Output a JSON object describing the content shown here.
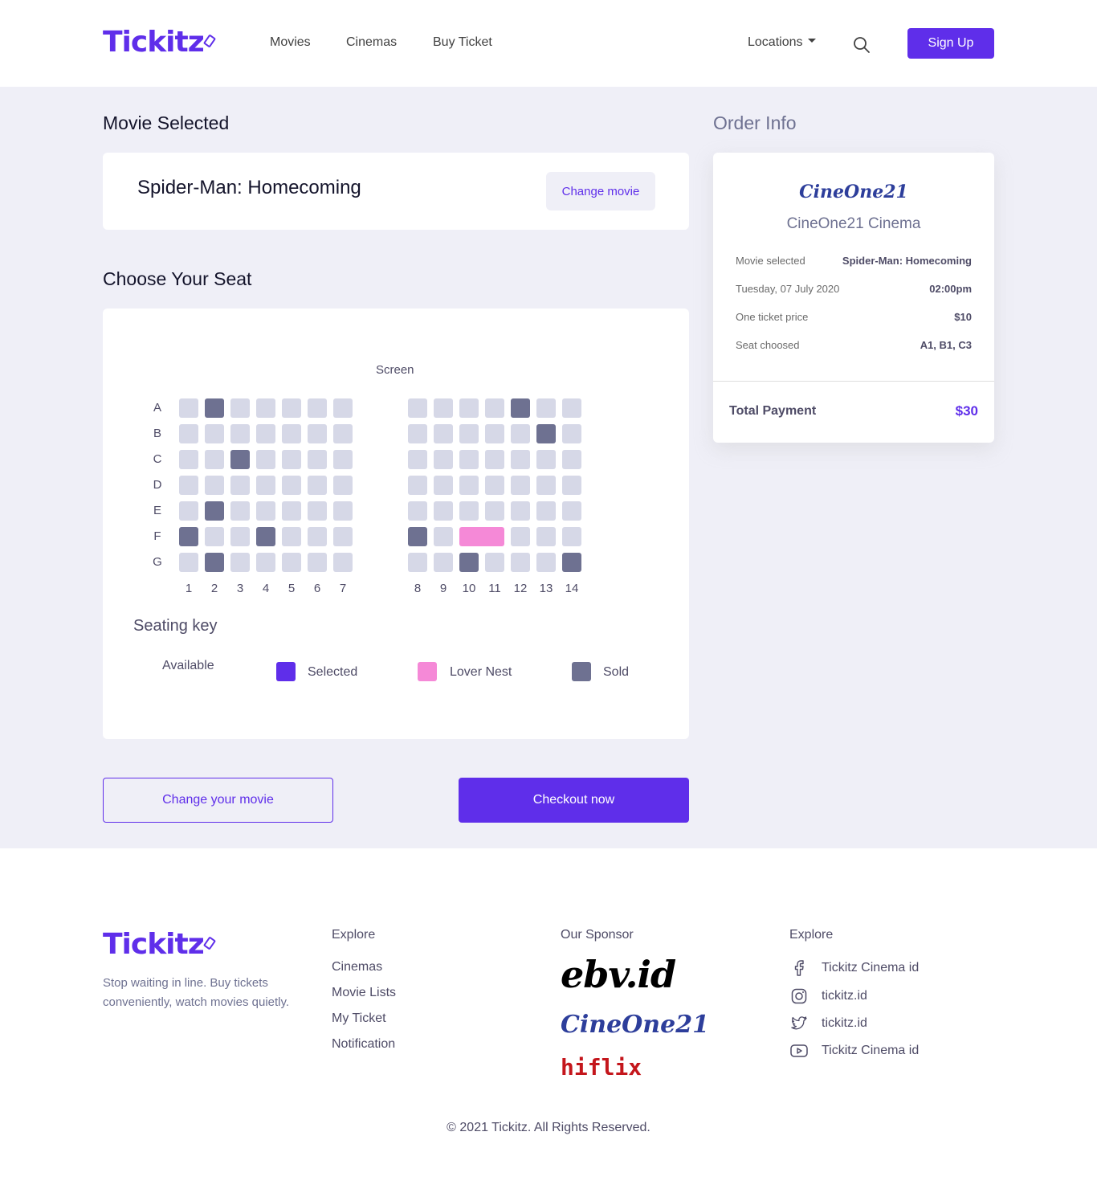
{
  "header": {
    "logo": "Tickitz",
    "nav": [
      "Movies",
      "Cinemas",
      "Buy Ticket"
    ],
    "locations": "Locations",
    "signup": "Sign Up"
  },
  "movie_selected": {
    "title": "Movie Selected",
    "movie": "Spider-Man: Homecoming",
    "change_button": "Change movie"
  },
  "seat_section": {
    "title": "Choose Your Seat",
    "screen": "Screen",
    "rows": [
      "A",
      "B",
      "C",
      "D",
      "E",
      "F",
      "G"
    ],
    "columns": [
      "1",
      "2",
      "3",
      "4",
      "5",
      "6",
      "7",
      "8",
      "9",
      "10",
      "11",
      "12",
      "13",
      "14"
    ],
    "sold": [
      "A2",
      "A12",
      "B13",
      "C3",
      "E2",
      "F1",
      "F4",
      "F8",
      "G2",
      "G10",
      "G14"
    ],
    "lover_nest": [
      "F10-F11"
    ],
    "seating_key_title": "Seating key",
    "keys": [
      "Available",
      "Selected",
      "Lover Nest",
      "Sold"
    ]
  },
  "actions": {
    "change": "Change your movie",
    "checkout": "Checkout now"
  },
  "order_info": {
    "title": "Order Info",
    "cinema_logo": "CineOne21",
    "cinema_name": "CineOne21 Cinema",
    "rows": [
      {
        "label": "Movie selected",
        "value": "Spider-Man: Homecoming"
      },
      {
        "label": "Tuesday, 07 July 2020",
        "value": "02:00pm"
      },
      {
        "label": "One ticket price",
        "value": "$10"
      },
      {
        "label": "Seat choosed",
        "value": "A1, B1, C3"
      }
    ],
    "total_label": "Total Payment",
    "total_value": "$30"
  },
  "colors": {
    "primary": "#5f2eea",
    "available": "#d6d8e7",
    "sold": "#6e7191",
    "lover_nest": "#f589d7",
    "background": "#efeff7"
  },
  "footer": {
    "logo": "Tickitz",
    "description": "Stop waiting in line. Buy tickets conveniently, watch movies quietly.",
    "explore_title": "Explore",
    "explore_links": [
      "Cinemas",
      "Movie Lists",
      "My Ticket",
      "Notification"
    ],
    "sponsor_title": "Our Sponsor",
    "sponsors": [
      "ebv.id",
      "CineOne21",
      "hiflix"
    ],
    "follow_title": "Explore",
    "socials": [
      {
        "icon": "facebook-icon",
        "label": "Tickitz Cinema id"
      },
      {
        "icon": "instagram-icon",
        "label": "tickitz.id"
      },
      {
        "icon": "twitter-icon",
        "label": "tickitz.id"
      },
      {
        "icon": "youtube-icon",
        "label": "Tickitz Cinema id"
      }
    ],
    "copyright": "© 2021 Tickitz. All Rights Reserved."
  }
}
